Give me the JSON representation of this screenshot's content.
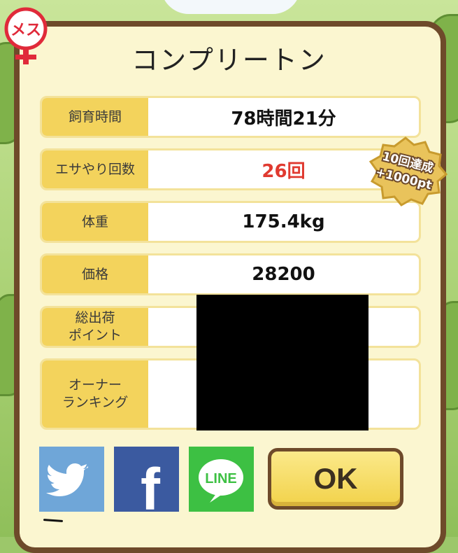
{
  "title": "コンプリートン",
  "gender_label": "メス",
  "stats": [
    {
      "label": "飼育時間",
      "value": "78時間21分"
    },
    {
      "label": "エサやり回数",
      "value": "26回"
    },
    {
      "label": "体重",
      "value": "175.4kg"
    },
    {
      "label": "価格",
      "value": "28200"
    },
    {
      "label": "総出荷\nポイント",
      "value": ""
    },
    {
      "label": "オーナー\nランキング",
      "value": ""
    }
  ],
  "badge": {
    "line1": "10回達成",
    "line2": "+1000pt"
  },
  "share": {
    "line_label": "LINE",
    "facebook_glyph": "f"
  },
  "ok_label": "OK",
  "colors": {
    "accent_red": "#e03a30",
    "label_yellow": "#f3d35c",
    "frame_brown": "#6e4a2a"
  }
}
